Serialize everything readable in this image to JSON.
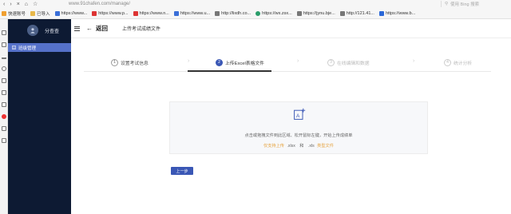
{
  "browser": {
    "url": "www.91chafen.com/manage/",
    "search_placeholder": "使用 Bing 搜索",
    "bookmarks": [
      {
        "label": "快速账号",
        "color": "#f0a030"
      },
      {
        "label": "已导入",
        "color": "#e8b84a"
      },
      {
        "label": "https://www...",
        "color": "#3a6fd8"
      },
      {
        "label": "https://www.p...",
        "color": "#d33"
      },
      {
        "label": "https://www.n...",
        "color": "#d33"
      },
      {
        "label": "https://www.u...",
        "color": "#3a6fd8"
      },
      {
        "label": "http://lixdh.co...",
        "color": "#777"
      },
      {
        "label": "https://wx.zsx...",
        "color": "#2a9d6a"
      },
      {
        "label": "https://jynu.bje...",
        "color": "#777"
      },
      {
        "label": "http://121.41...",
        "color": "#777"
      },
      {
        "label": "https://www.b...",
        "color": "#2a67d8"
      }
    ]
  },
  "sidebar": {
    "user_name": "分查查",
    "items": [
      {
        "label": "班级管理"
      }
    ]
  },
  "header": {
    "back_label": "返回",
    "page_title": "上传考试成绩文件"
  },
  "steps": [
    {
      "index": "1",
      "label": "设置考试信息",
      "state": "done"
    },
    {
      "index": "2",
      "label": "上传Excel表格文件",
      "state": "active"
    },
    {
      "index": "3",
      "label": "在线编辑和数据",
      "state": "todo"
    },
    {
      "index": "4",
      "label": "统计分析",
      "state": "todo"
    }
  ],
  "upload": {
    "hint": "点击或拖拽文件到此区域、松开鼠标左键，开始上传成绩单",
    "support_prefix": "仅支持上传",
    "ext_xlsx": ".xlsx",
    "or_text": "和",
    "ext_xls": ".xls",
    "support_suffix": "类型文件"
  },
  "actions": {
    "prev_label": "上一步"
  },
  "colors": {
    "primary": "#3a57b5",
    "sidebar_bg": "#0d1a33",
    "warning": "#e6a23c"
  }
}
